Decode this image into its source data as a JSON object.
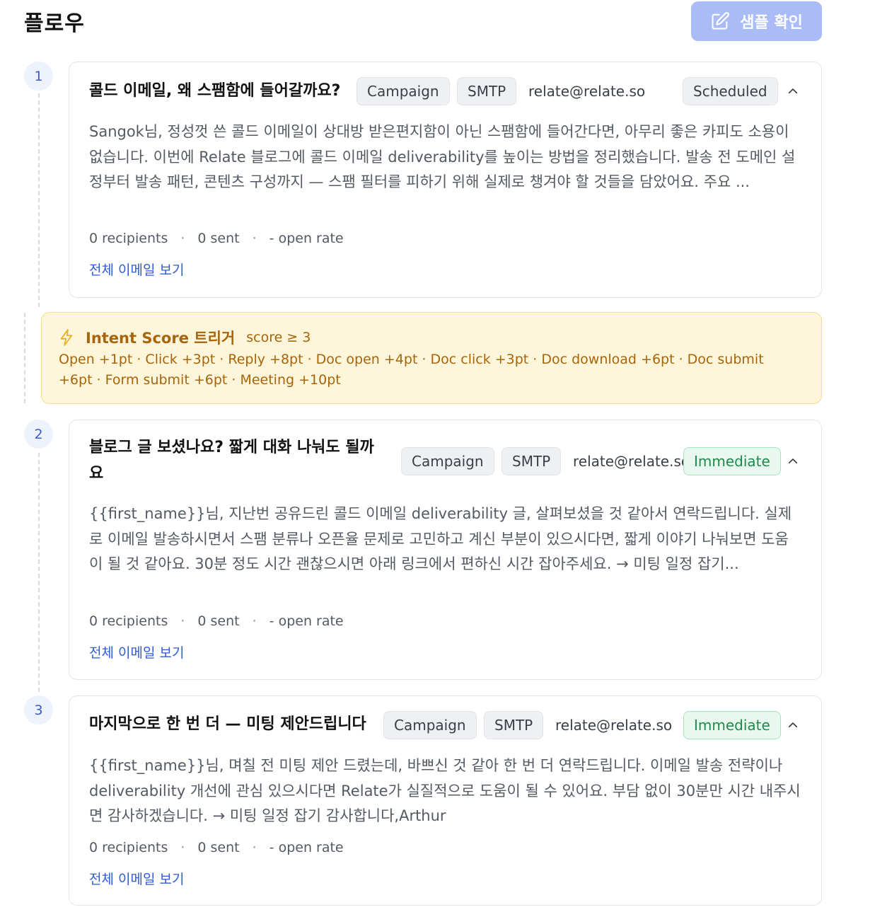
{
  "header": {
    "title": "플로우",
    "sample_button_label": "샘플 확인"
  },
  "trigger": {
    "title": "Intent Score 트리거",
    "condition": "score ≥ 3",
    "rules": "Open +1pt · Click +3pt · Reply +8pt · Doc open +4pt · Doc click +3pt · Doc download +6pt · Doc submit +6pt · Form submit +6pt · Meeting +10pt"
  },
  "steps": [
    {
      "number": "1",
      "title": "콜드 이메일, 왜 스팸함에 들어갈까요?",
      "type_badge": "Campaign",
      "channel_badge": "SMTP",
      "sender": "relate@relate.so",
      "timing_badge": "Scheduled",
      "body": "Sangok님, 정성껏 쓴 콜드 이메일이 상대방 받은편지함이 아닌 스팸함에 들어간다면, 아무리 좋은 카피도 소용이 없습니다. 이번에 Relate 블로그에 콜드 이메일 deliverability를 높이는 방법을 정리했습니다. 발송 전 도메인 설정부터 발송 패턴, 콘텐츠 구성까지 — 스팸 필터를 피하기 위해 실제로 챙겨야 할 것들을 담았어요. 주요 ...",
      "recipients": "0 recipients",
      "sent": "0 sent",
      "open_rate": "- open rate",
      "view_link": "전체 이메일 보기"
    },
    {
      "number": "2",
      "title": "블로그 글 보셨나요? 짧게 대화 나눠도 될까요",
      "type_badge": "Campaign",
      "channel_badge": "SMTP",
      "sender": "relate@relate.so",
      "timing_badge": "Immediate",
      "body": "{{first_name}}님, 지난번 공유드린 콜드 이메일 deliverability 글, 살펴보셨을 것 같아서 연락드립니다. 실제로 이메일 발송하시면서 스팸 분류나 오픈율 문제로 고민하고 계신 부분이 있으시다면, 짧게 이야기 나눠보면 도움이 될 것 같아요. 30분 정도 시간 괜찮으시면 아래 링크에서 편하신 시간 잡아주세요. → 미팅 일정 잡기...",
      "recipients": "0 recipients",
      "sent": "0 sent",
      "open_rate": "- open rate",
      "view_link": "전체 이메일 보기"
    },
    {
      "number": "3",
      "title": "마지막으로 한 번 더 — 미팅 제안드립니다",
      "type_badge": "Campaign",
      "channel_badge": "SMTP",
      "sender": "relate@relate.so",
      "timing_badge": "Immediate",
      "body": "{{first_name}}님, 며칠 전 미팅 제안 드렸는데, 바쁘신 것 같아 한 번 더 연락드립니다. 이메일 발송 전략이나 deliverability 개선에 관심 있으시다면 Relate가 실질적으로 도움이 될 수 있어요. 부담 없이 30분만 시간 내주시면 감사하겠습니다. → 미팅 일정 잡기 감사합니다,Arthur",
      "recipients": "0 recipients",
      "sent": "0 sent",
      "open_rate": "- open rate",
      "view_link": "전체 이메일 보기"
    }
  ],
  "colors": {
    "accent": "#a9bcf5",
    "link": "#2f5bd8",
    "trigger_bg": "#fef6db",
    "trigger_text": "#a8640b",
    "immediate_bg": "#e9f8ef",
    "immediate_text": "#1f8a4c"
  },
  "icons": {
    "sample_button": "edit-icon",
    "trigger": "lightning-icon",
    "collapse": "chevron-up-icon"
  }
}
